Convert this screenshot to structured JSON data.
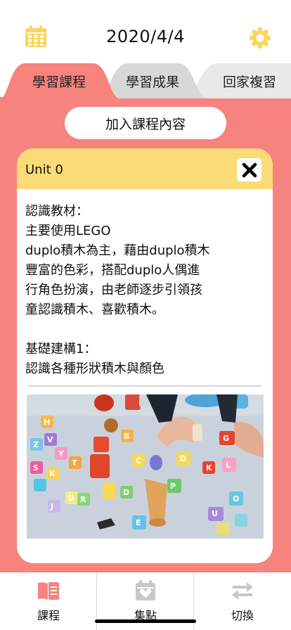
{
  "header": {
    "date": "2020/4/4",
    "calendar_icon": "calendar-icon",
    "settings_icon": "gear-icon",
    "accent_color": "#fcd55f"
  },
  "tabs": [
    {
      "label": "學習課程",
      "active": true,
      "color": "#f6837d"
    },
    {
      "label": "學習成果",
      "active": false,
      "color": "#d8d8d8"
    },
    {
      "label": "回家複習",
      "active": false,
      "color": "#e9e9e9"
    }
  ],
  "main": {
    "background_color": "#f6837d",
    "add_button_label": "加入課程內容",
    "card": {
      "title": "Unit 0",
      "header_color": "#fbdb78",
      "close_icon": "close-icon",
      "content": "認識教材：\n主要使用LEGO\nduplo積木為主，藉由duplo積木\n豐富的色彩，搭配duplo人偶進\n行角色扮演，由老師逐步引領孩\n童認識積木、喜歡積木。\n\n基礎建構1：\n認識各種形狀積木與顏色",
      "image": "LEGO duplo blocks photo"
    }
  },
  "bottom_nav": {
    "items": [
      {
        "label": "課程",
        "icon": "book-icon",
        "active": true,
        "color": "#f6837d"
      },
      {
        "label": "集點",
        "icon": "calendar-heart-icon",
        "active": false,
        "color": "#c7c7c7"
      },
      {
        "label": "切換",
        "icon": "swap-arrows-icon",
        "active": false,
        "color": "#c7c7c7"
      }
    ]
  }
}
